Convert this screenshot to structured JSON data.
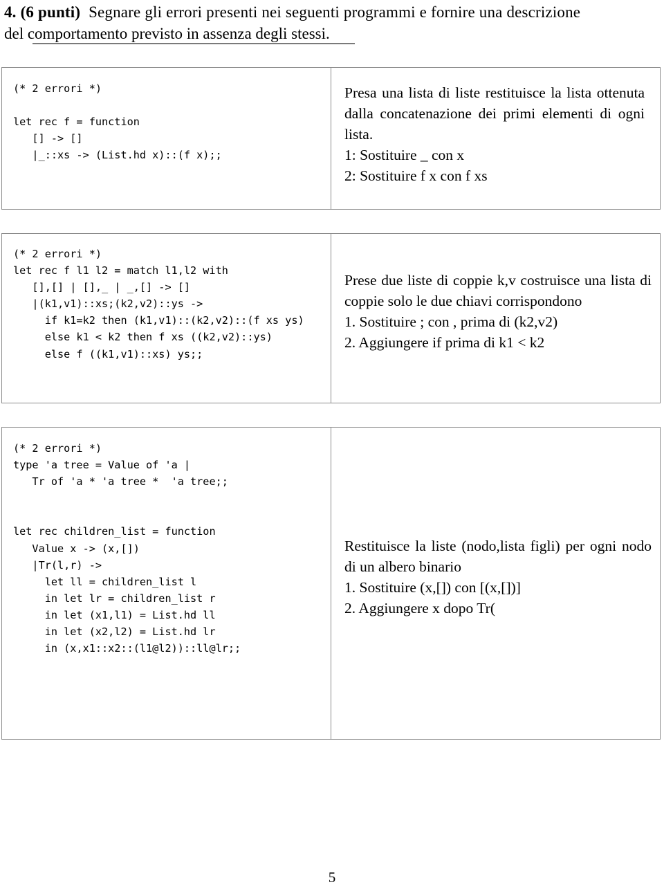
{
  "question": {
    "number": "4.",
    "points": "(6 punti)",
    "line1": "Segnare gli errori presenti nei seguenti programmi e fornire una descrizione",
    "line2": "del comportamento previsto in assenza degli stessi."
  },
  "blocks": [
    {
      "code": "(* 2 errori *)\n\nlet rec f = function\n   [] -> []\n   |_::xs -> (List.hd x)::(f x);;",
      "description": {
        "paragraph": "Presa una lista di liste restituisce la lista ottenuta dalla concatenazione dei primi elementi di ogni lista.",
        "fixes": [
          "1: Sostituire _ con x",
          "2: Sostituire f x con f xs"
        ]
      }
    },
    {
      "code": "(* 2 errori *)\nlet rec f l1 l2 = match l1,l2 with\n   [],[] | [],_ | _,[] -> []\n   |(k1,v1)::xs;(k2,v2)::ys ->\n     if k1=k2 then (k1,v1)::(k2,v2)::(f xs ys)\n     else k1 < k2 then f xs ((k2,v2)::ys)\n     else f ((k1,v1)::xs) ys;;",
      "description": {
        "paragraph": "Prese due liste di coppie k,v costruisce una lista di coppie solo le due chiavi corrispondono",
        "fixes": [
          "1. Sostituire ; con , prima di (k2,v2)",
          "2. Aggiungere if prima di k1 < k2"
        ]
      }
    },
    {
      "code": "(* 2 errori *)\ntype 'a tree = Value of 'a |\n   Tr of 'a * 'a tree *  'a tree;;\n\n\nlet rec children_list = function\n   Value x -> (x,[])\n   |Tr(l,r) ->\n     let ll = children_list l\n     in let lr = children_list r\n     in let (x1,l1) = List.hd ll\n     in let (x2,l2) = List.hd lr\n     in (x,x1::x2::(l1@l2))::ll@lr;;",
      "description": {
        "paragraph": "Restituisce la liste (nodo,lista figli) per ogni nodo di un albero binario",
        "fixes": [
          "1. Sostituire (x,[]) con [(x,[])]",
          "2. Aggiungere x dopo Tr("
        ]
      }
    }
  ],
  "footer": {
    "page_number": "5"
  }
}
